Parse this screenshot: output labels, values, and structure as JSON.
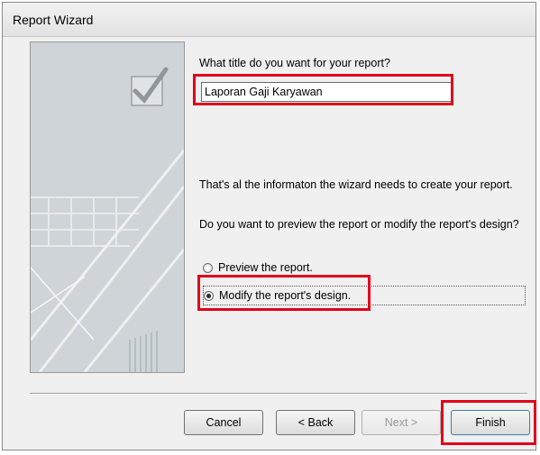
{
  "window": {
    "title": "Report Wizard"
  },
  "main": {
    "title_question": "What title do you want for your report?",
    "title_value": "Laporan Gaji Karyawan",
    "info_text": "That's al the informaton the wizard needs to create your report.",
    "next_question": "Do you want to preview the report or modify the report's design?",
    "options": [
      {
        "label": "Preview the report.",
        "checked": false
      },
      {
        "label": "Modify the report's design.",
        "checked": true
      }
    ]
  },
  "buttons": {
    "cancel": "Cancel",
    "back": "< Back",
    "next": "Next >",
    "finish": "Finish"
  },
  "colors": {
    "highlight": "#e0001b",
    "art_background": "#c9cfd3"
  }
}
